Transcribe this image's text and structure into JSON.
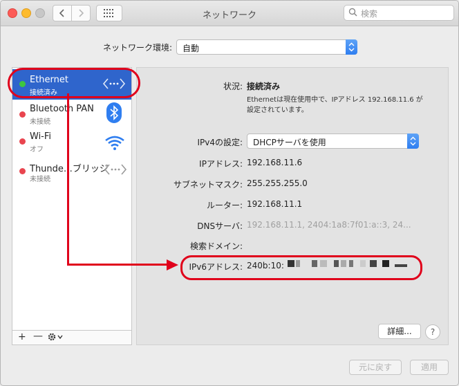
{
  "window": {
    "title": "ネットワーク",
    "search_placeholder": "検索"
  },
  "location": {
    "label": "ネットワーク環境:",
    "value": "自動"
  },
  "services": [
    {
      "name": "Ethernet",
      "status": "接続済み",
      "color": "green",
      "icon": "ethernet-icon",
      "selected": true
    },
    {
      "name": "Bluetooth PAN",
      "status": "未接続",
      "color": "red",
      "icon": "bluetooth-icon"
    },
    {
      "name": "Wi-Fi",
      "status": "オフ",
      "color": "red",
      "icon": "wifi-icon"
    },
    {
      "name": "Thunde…ブリッジ",
      "status": "未接続",
      "color": "red",
      "icon": "thunderbolt-bridge-icon"
    }
  ],
  "sidebar_toolbar": {
    "add": "+",
    "remove": "—"
  },
  "detail": {
    "status_label": "状況:",
    "status_value": "接続済み",
    "status_desc": "Ethernetは現在使用中で、IPアドレス 192.168.11.6 が設定されています。",
    "ipv4_label": "IPv4の設定:",
    "ipv4_value": "DHCPサーバを使用",
    "ip_label": "IPアドレス:",
    "ip_value": "192.168.11.6",
    "subnet_label": "サブネットマスク:",
    "subnet_value": "255.255.255.0",
    "router_label": "ルーター:",
    "router_value": "192.168.11.1",
    "dns_label": "DNSサーバ:",
    "dns_value": "192.168.11.1, 2404:1a8:7f01:a::3, 24...",
    "domain_label": "検索ドメイン:",
    "ipv6_label": "IPv6アドレス:",
    "ipv6_value": "240b:10:"
  },
  "buttons": {
    "advanced": "詳細...",
    "help": "?",
    "revert": "元に戻す",
    "apply": "適用"
  },
  "colors": {
    "accent": "#2f65cc",
    "highlight": "#e0001b"
  }
}
